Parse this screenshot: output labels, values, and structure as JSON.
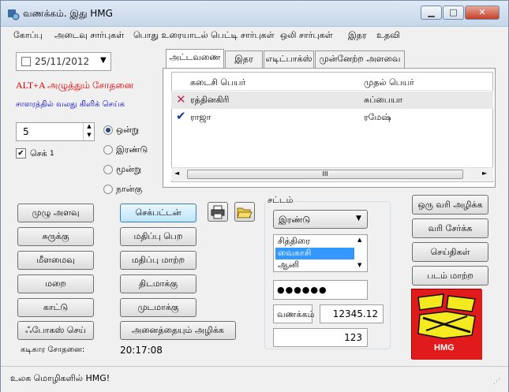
{
  "window": {
    "title": "வணக்கம். இது HMG",
    "minimize_icon": "minimize-icon",
    "maximize_icon": "maximize-icon",
    "close_icon": "close-icon"
  },
  "menu": [
    {
      "label": "கோப்பு"
    },
    {
      "label": "அடைவு சார்புகள்"
    },
    {
      "label": "பொது உரையாடல் பெட்டி சார்புகள்"
    },
    {
      "label": "ஒலி சார்புகள்"
    },
    {
      "label": "இதர"
    },
    {
      "label": "உதவி"
    }
  ],
  "left": {
    "date_value": "25/11/2012",
    "red_label": "ALT+A அழுத்தும் சோதனை",
    "blue_label": "சாளரத்தில் வலது கிளிக் செய்க",
    "spinner_value": "5",
    "check_label": "செக்",
    "check_count": "1",
    "radios": [
      "ஒன்று",
      "இரண்டு",
      "மூன்று",
      "நான்கு"
    ],
    "checked_radio": 0
  },
  "tabs": [
    "அட்டவணை",
    "இதர",
    "எடிட்பாக்ஸ்",
    "முன்னேற்ற அளவை"
  ],
  "table": {
    "columns": [
      "கடைசி பெயர்",
      "முதல் பெயர்"
    ],
    "rows": [
      {
        "mark": "cross-icon",
        "last": "ரத்தினகிரி",
        "first": "சுப்பையா"
      },
      {
        "mark": "check-icon",
        "last": "ராஜா",
        "first": "ரமேஷ்"
      }
    ],
    "scroll_grip": "III"
  },
  "buttons_left": [
    "முழு அளவு",
    "சுருக்கு",
    "மீளமைவு",
    "மறை",
    "காட்டு",
    "ஃபோகஸ் செய்"
  ],
  "buttons_mid": [
    "செக்பட்டன்",
    "மதிப்பு பெற",
    "மதிப்பு மாற்ற",
    "திடமாக்கு",
    "முடமாக்கு",
    "அனைத்தையும் அழிக்க"
  ],
  "timer_label": "கடிகார சோதனை:",
  "timer_value": "20:17:08",
  "print_icon": "printer-icon",
  "folder_icon": "open-folder-icon",
  "group": {
    "label": "சட்டம்",
    "combo_value": "இரண்டு",
    "list_items": [
      "சித்திரை",
      "வைகாசி",
      "ஆனி"
    ],
    "selected_item": 1,
    "password_mask": "●●●●●●",
    "vanakkam_label": "வணக்கம்",
    "number_value": "12345.12",
    "number_value_2": "123"
  },
  "buttons_right": [
    "ஒரு வரி அழிக்க",
    "வரி சேர்க்க",
    "செய்திகள்",
    "படம் மாற்ற"
  ],
  "logo_text": "HMG",
  "status_text": "உலக மொழிகளில் HMG!"
}
